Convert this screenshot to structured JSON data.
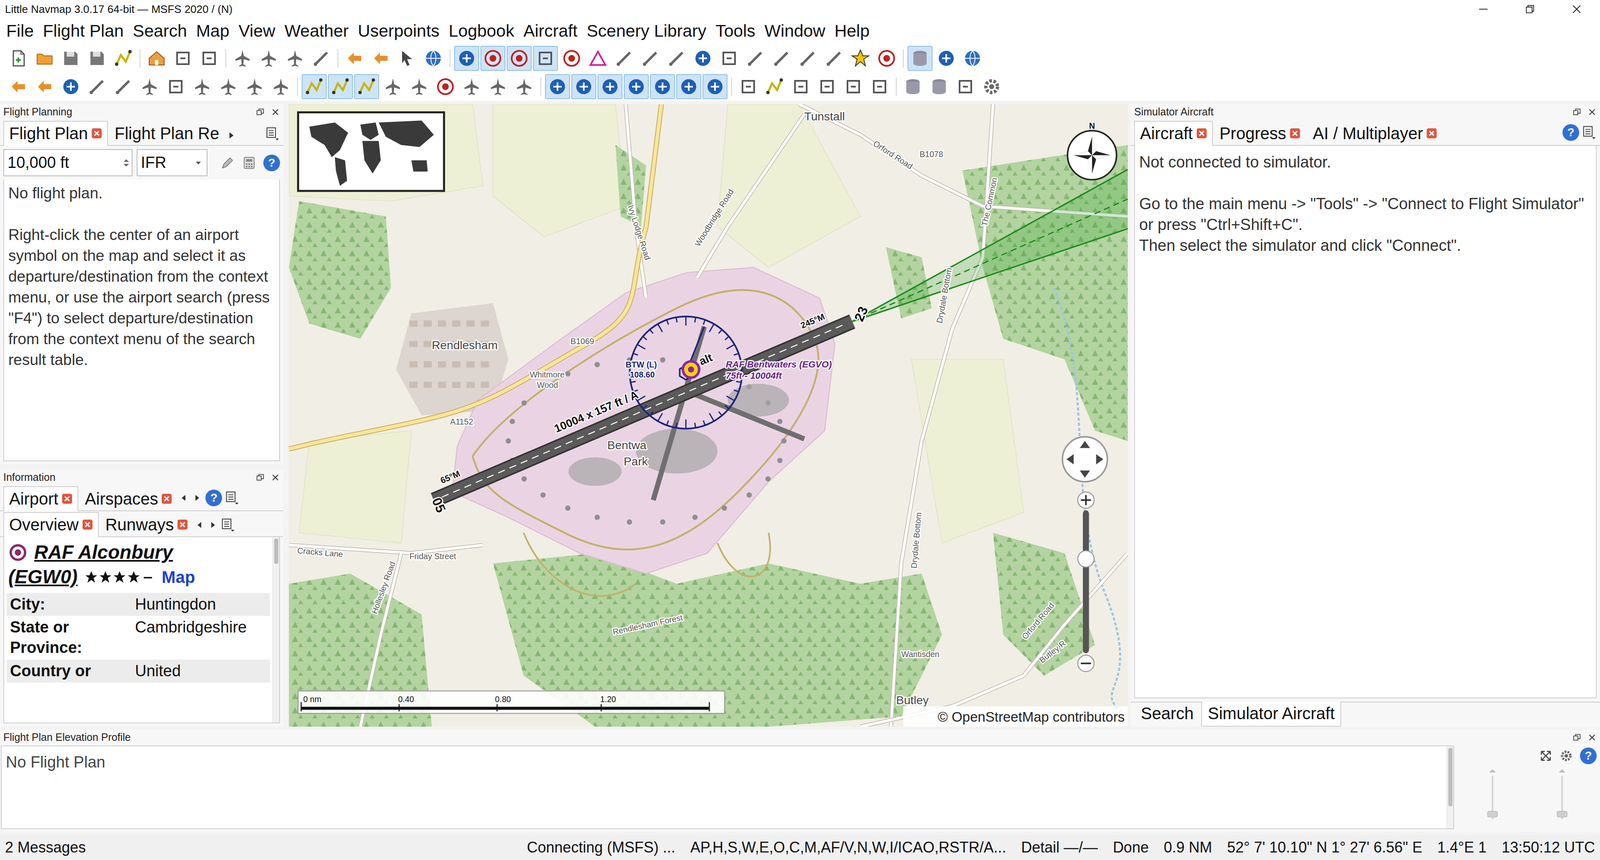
{
  "window": {
    "title": "Little Navmap 3.0.17 64-bit — MSFS 2020 / (N)"
  },
  "menu": [
    "File",
    "Flight Plan",
    "Search",
    "Map",
    "View",
    "Weather",
    "Userpoints",
    "Logbook",
    "Aircraft",
    "Scenery Library",
    "Tools",
    "Window",
    "Help"
  ],
  "toolbars": [
    {
      "groups": [
        [
          {
            "checked": false
          },
          {
            "checked": false
          },
          {
            "checked": false
          },
          {
            "checked": false
          },
          {
            "checked": false
          }
        ],
        [
          {
            "checked": false
          },
          {
            "checked": false
          },
          {
            "checked": false
          }
        ],
        [
          {
            "checked": false
          },
          {
            "checked": false
          },
          {
            "checked": false
          },
          {
            "checked": false
          }
        ],
        [
          {
            "checked": false
          },
          {
            "checked": false
          },
          {
            "checked": false
          },
          {
            "checked": false
          }
        ],
        [
          {
            "checked": true
          },
          {
            "checked": true
          },
          {
            "checked": true
          },
          {
            "checked": true
          },
          {
            "checked": false
          },
          {
            "checked": false
          },
          {
            "checked": false
          },
          {
            "checked": false
          },
          {
            "checked": false
          },
          {
            "checked": false
          },
          {
            "checked": false
          },
          {
            "checked": false
          },
          {
            "checked": false
          },
          {
            "checked": false
          },
          {
            "checked": false
          },
          {
            "checked": false
          },
          {
            "checked": false
          }
        ],
        [
          {
            "checked": true
          },
          {
            "checked": false
          },
          {
            "checked": false
          }
        ]
      ]
    },
    {
      "groups": [
        [
          {
            "checked": false
          },
          {
            "checked": false
          },
          {
            "checked": false
          },
          {
            "checked": false
          },
          {
            "checked": false
          },
          {
            "checked": false
          },
          {
            "checked": false
          },
          {
            "checked": false
          },
          {
            "checked": false
          },
          {
            "checked": false
          },
          {
            "checked": false
          }
        ],
        [
          {
            "checked": true
          },
          {
            "checked": true
          },
          {
            "checked": true
          },
          {
            "checked": false
          },
          {
            "checked": false
          },
          {
            "checked": false
          },
          {
            "checked": false
          },
          {
            "checked": false
          },
          {
            "checked": false
          }
        ],
        [
          {
            "checked": true
          },
          {
            "checked": true
          },
          {
            "checked": true
          },
          {
            "checked": true
          },
          {
            "checked": true
          },
          {
            "checked": true
          },
          {
            "checked": true
          }
        ],
        [
          {
            "checked": false
          },
          {
            "checked": false
          },
          {
            "checked": false
          },
          {
            "checked": false
          },
          {
            "checked": false
          },
          {
            "checked": false
          }
        ],
        [
          {
            "checked": false
          },
          {
            "checked": false
          },
          {
            "checked": false
          },
          {
            "checked": false
          }
        ]
      ]
    }
  ],
  "flight_planning": {
    "title": "Flight Planning",
    "tabs": [
      {
        "label": "Flight Plan",
        "selected": true,
        "closable": true
      },
      {
        "label": "Flight Plan Re",
        "selected": false,
        "closable": false
      }
    ],
    "altitude": "10,000 ft",
    "rule": "IFR",
    "help": "?",
    "message": "No flight plan.",
    "hint": "Right-click the center of an airport symbol on the map and select it as departure/destination from the context menu, or use the airport search (press \"F4\") to select departure/destination from the context menu of the search result table."
  },
  "information": {
    "title": "Information",
    "tabs": [
      {
        "label": "Airport",
        "selected": true,
        "closable": true
      },
      {
        "label": "Airspaces",
        "selected": false,
        "closable": true
      }
    ],
    "subtabs": [
      {
        "label": "Overview",
        "selected": true,
        "closable": true
      },
      {
        "label": "Runways",
        "selected": false,
        "closable": true
      }
    ],
    "help": "?",
    "airport": {
      "name": "RAF Alconbury",
      "ident": "(EGW0)",
      "stars": 4,
      "stars_max": 5,
      "map_link": "Map",
      "fields": [
        {
          "label": "City:",
          "value": "Huntingdon"
        },
        {
          "label": "State or Province:",
          "value": "Cambridgeshire"
        },
        {
          "label": "Country or",
          "value": "United"
        }
      ]
    }
  },
  "map": {
    "labels": [
      {
        "text": "Tunstall",
        "kind": "place"
      },
      {
        "text": "Orford Road",
        "kind": "road"
      },
      {
        "text": "B1078",
        "kind": "road"
      },
      {
        "text": "Ivy Lodge Road",
        "kind": "road"
      },
      {
        "text": "Woodbridge Road",
        "kind": "road"
      },
      {
        "text": "The Common",
        "kind": "road"
      },
      {
        "text": "Rendlesham",
        "kind": "place"
      },
      {
        "text": "B1069",
        "kind": "road"
      },
      {
        "text": "Whitmore",
        "kind": "road"
      },
      {
        "text": "Wood",
        "kind": "road"
      },
      {
        "text": "A1152",
        "kind": "road"
      },
      {
        "text": "Bentwa",
        "kind": "place"
      },
      {
        "text": "Park",
        "kind": "place"
      },
      {
        "text": "10004 x 157 ft / A",
        "kind": "runway"
      },
      {
        "text": "alt",
        "kind": "runway"
      },
      {
        "text": "BTW (L)",
        "kind": "navaid"
      },
      {
        "text": "108.60",
        "kind": "navaid"
      },
      {
        "text": "RAF Bentwaters (EGVO)",
        "kind": "airport"
      },
      {
        "text": "75ft - 10004ft",
        "kind": "airport"
      },
      {
        "text": "245°M",
        "kind": "heading"
      },
      {
        "text": "23",
        "kind": "rwyend"
      },
      {
        "text": "65°M",
        "kind": "heading"
      },
      {
        "text": "05",
        "kind": "rwyend"
      },
      {
        "text": "Drydale Bottom",
        "kind": "road"
      },
      {
        "text": "Drydale Bottom",
        "kind": "road"
      },
      {
        "text": "Cracks Lane",
        "kind": "road"
      },
      {
        "text": "Friday Street",
        "kind": "road"
      },
      {
        "text": "Hollesley Road",
        "kind": "road"
      },
      {
        "text": "Rendlesham Forest",
        "kind": "road"
      },
      {
        "text": "Wantisden",
        "kind": "road"
      },
      {
        "text": "Orford Road",
        "kind": "road"
      },
      {
        "text": "Butley",
        "kind": "place"
      },
      {
        "text": "Butley R",
        "kind": "road"
      }
    ],
    "compass": "N",
    "zoom": {
      "level": 0.66
    },
    "scale": [
      "0 nm",
      "0.40",
      "0.80",
      "1.20"
    ],
    "attribution": "© OpenStreetMap contributors"
  },
  "simulator_aircraft": {
    "title": "Simulator Aircraft",
    "tabs": [
      {
        "label": "Aircraft",
        "selected": true,
        "closable": true
      },
      {
        "label": "Progress",
        "selected": false,
        "closable": true
      },
      {
        "label": "AI / Multiplayer",
        "selected": false,
        "closable": true
      }
    ],
    "help": "?",
    "status": "Not connected to simulator.",
    "instructions": [
      "Go to the main menu -> \"Tools\" -> \"Connect to Flight Simulator\" or press \"Ctrl+Shift+C\".",
      "Then select the simulator and click \"Connect\"."
    ],
    "bottom_tabs": [
      {
        "label": "Search",
        "selected": false
      },
      {
        "label": "Simulator Aircraft",
        "selected": true
      }
    ]
  },
  "elevation_profile": {
    "title": "Flight Plan Elevation Profile",
    "message": "No Flight Plan",
    "help": "?",
    "sliders": [
      {
        "level": 0.1
      },
      {
        "level": 0.1
      }
    ]
  },
  "status_bar": [
    "2 Messages",
    "Connecting (MSFS) ...",
    "AP,H,S,W,E,O,C,M,AF/V,N,W,I/ICAO,RSTR/A...",
    "Detail —/—",
    "Done",
    "0.9 NM",
    "52° 7' 10.10\" N 1° 27' 6.56\" E",
    "1.4°E 1",
    "13:50:12 UTC"
  ]
}
